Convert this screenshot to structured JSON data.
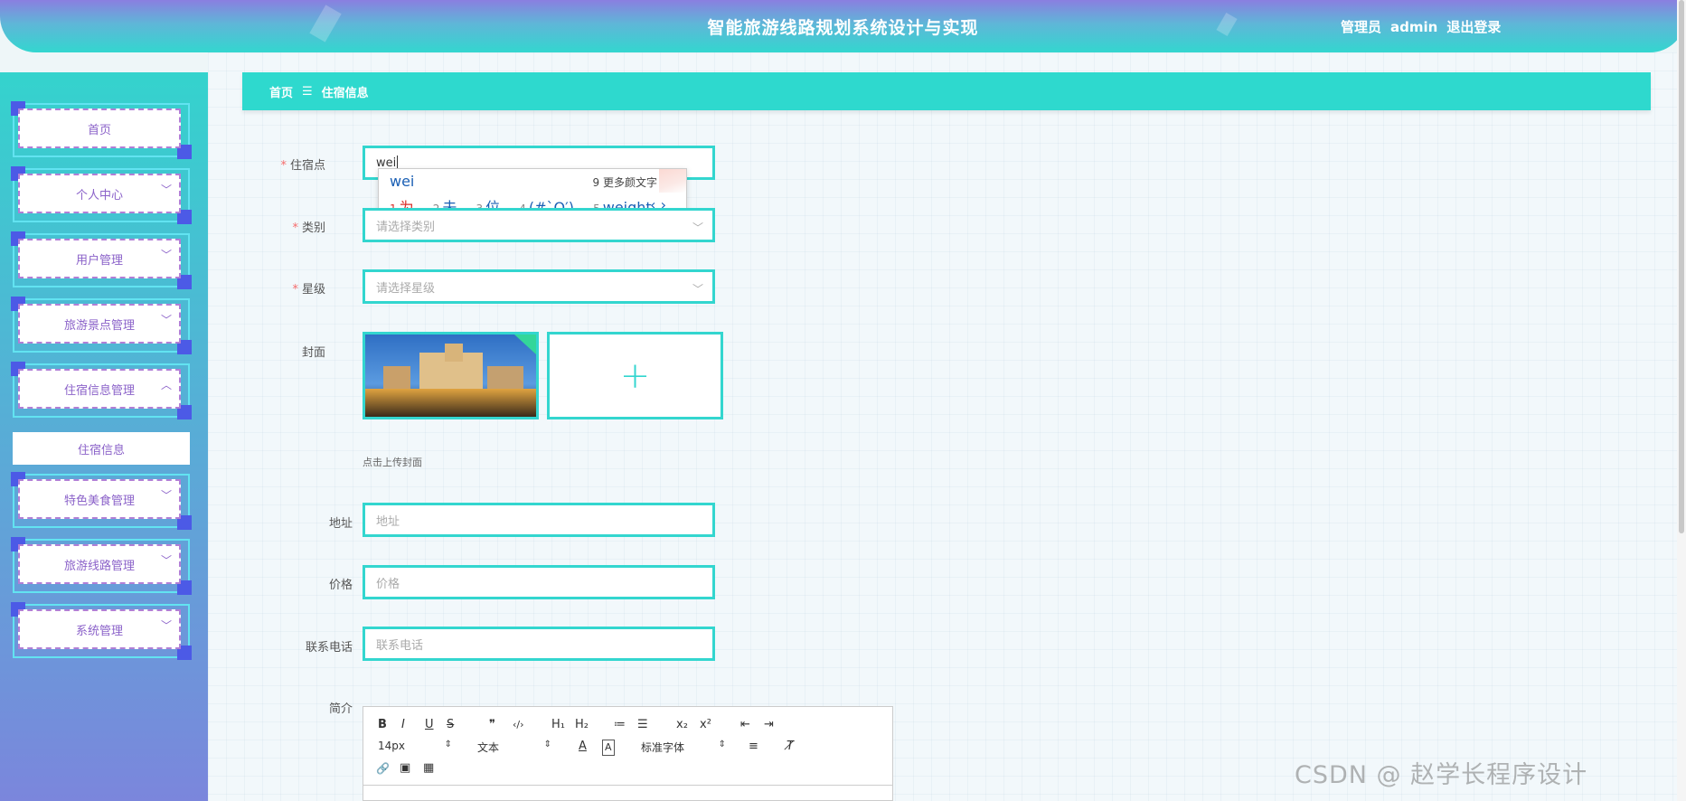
{
  "header": {
    "title": "智能旅游线路规划系统设计与实现",
    "user_role": "管理员",
    "username": "admin",
    "logout": "退出登录"
  },
  "sidebar": {
    "items": [
      {
        "label": "首页",
        "has_chevron": false
      },
      {
        "label": "个人中心",
        "has_chevron": true
      },
      {
        "label": "用户管理",
        "has_chevron": true
      },
      {
        "label": "旅游景点管理",
        "has_chevron": true
      },
      {
        "label": "住宿信息管理",
        "has_chevron": true,
        "expanded": true
      },
      {
        "label": "特色美食管理",
        "has_chevron": true
      },
      {
        "label": "旅游线路管理",
        "has_chevron": true
      },
      {
        "label": "系统管理",
        "has_chevron": true
      }
    ],
    "submenu": {
      "label": "住宿信息"
    }
  },
  "breadcrumb": {
    "home": "首页",
    "separator": "☰",
    "current": "住宿信息"
  },
  "form": {
    "lodging": {
      "label": "住宿点",
      "value": "wei",
      "required": true
    },
    "category": {
      "label": "类别",
      "placeholder": "请选择类别",
      "required": true
    },
    "star": {
      "label": "星级",
      "placeholder": "请选择星级",
      "required": true
    },
    "cover": {
      "label": "封面",
      "tip": "点击上传封面",
      "upload_symbol": "+"
    },
    "address": {
      "label": "地址",
      "placeholder": "地址"
    },
    "price": {
      "label": "价格",
      "placeholder": "价格"
    },
    "phone": {
      "label": "联系电话",
      "placeholder": "联系电话"
    },
    "intro": {
      "label": "简介"
    }
  },
  "ime": {
    "composition": "wei",
    "more": "9 更多颜文字",
    "candidates": [
      {
        "num": "1",
        "text": "为"
      },
      {
        "num": "2",
        "text": "未"
      },
      {
        "num": "3",
        "text": "位"
      },
      {
        "num": "4",
        "text": "(#`O′)"
      },
      {
        "num": "5",
        "text": "weight"
      }
    ],
    "nav": "‹ ›"
  },
  "editor": {
    "bold": "B",
    "italic": "I",
    "underline": "U",
    "strike": "S",
    "quote": "❞",
    "code": "‹/›",
    "h1": "H₁",
    "h2": "H₂",
    "ordered": "≔",
    "bullet": "☰",
    "sub": "x₂",
    "sup": "x²",
    "outdent": "⇤",
    "indent": "⇥",
    "size": "14px",
    "format": "文本",
    "font": "标准字体",
    "color": "A",
    "bg": "A",
    "align": "≡",
    "clear": "T̸",
    "link": "🔗",
    "image": "▣",
    "video": "▦"
  },
  "watermark": "CSDN @ 赵学长程序设计",
  "colors": {
    "accent": "#33d6cf",
    "menu_text": "#8b62c9",
    "required": "#f56c6c"
  }
}
